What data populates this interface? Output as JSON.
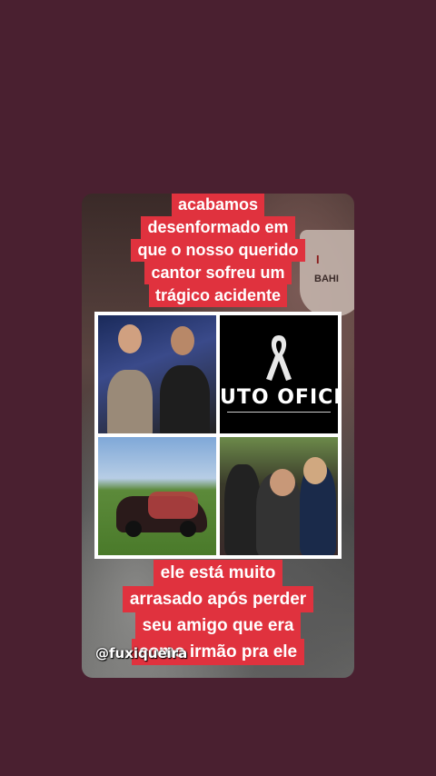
{
  "caption_top": [
    "acabamos",
    "desenformado em",
    "que o nosso querido",
    "cantor sofreu um",
    "trágico acidente"
  ],
  "caption_bottom": [
    "ele está muito",
    "arrasado após perder",
    "seu amigo que era",
    "como irmão pra ele"
  ],
  "collage": {
    "luto_text": "UTO OFICIA"
  },
  "watermark": "@fuxiqueira",
  "mug": {
    "line1": "I",
    "line2": "BAHI"
  },
  "colors": {
    "background": "#4a2030",
    "caption_bg": "#e0323e"
  }
}
